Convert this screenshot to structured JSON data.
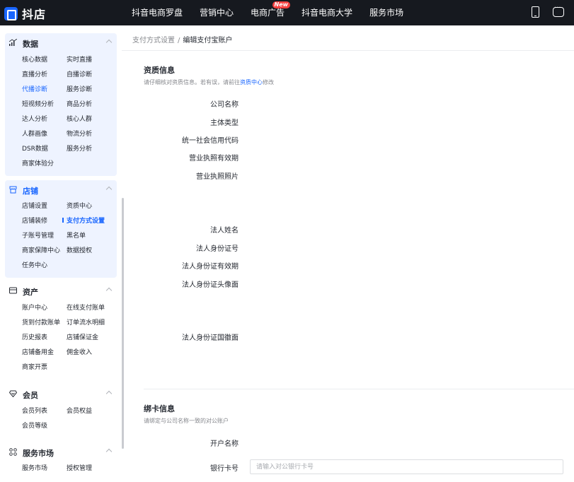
{
  "app": {
    "logo_text": "抖店"
  },
  "topnav": {
    "items": [
      {
        "label": "抖音电商罗盘"
      },
      {
        "label": "营销中心"
      },
      {
        "label": "电商广告",
        "badge": "New"
      },
      {
        "label": "抖音电商大学"
      },
      {
        "label": "服务市场"
      }
    ],
    "icons": [
      "phone-icon",
      "chat-icon"
    ]
  },
  "sidebar": {
    "groups": [
      {
        "title": "数据",
        "icon": "chart-icon",
        "items": [
          "核心数据",
          "实时直播",
          "直播分析",
          "自播诊断",
          "代播诊断",
          "服务诊断",
          "短视频分析",
          "商品分析",
          "达人分析",
          "核心人群",
          "人群画像",
          "物流分析",
          "DSR数据",
          "服务分析",
          "商家体验分"
        ],
        "active_item": "代播诊断"
      },
      {
        "title": "店铺",
        "icon": "store-icon",
        "items": [
          "店铺设置",
          "资质中心",
          "店铺装修",
          "支付方式设置",
          "子账号管理",
          "黑名单",
          "商家保障中心",
          "数据授权",
          "任务中心"
        ],
        "selected_item": "支付方式设置"
      },
      {
        "title": "资产",
        "icon": "wallet-icon",
        "items": [
          "账户中心",
          "在线支付账单",
          "货到付款账单",
          "订单流水明细",
          "历史报表",
          "店铺保证金",
          "店铺备用金",
          "佣金收入",
          "商家开票"
        ]
      },
      {
        "title": "会员",
        "icon": "member-icon",
        "items": [
          "会员列表",
          "会员权益",
          "会员等级"
        ]
      },
      {
        "title": "服务市场",
        "icon": "apps-icon",
        "items": [
          "服务市场",
          "授权管理"
        ]
      }
    ]
  },
  "breadcrumb": {
    "parent": "支付方式设置",
    "separator": "/",
    "current": "编辑支付宝账户"
  },
  "qualification": {
    "title": "资质信息",
    "subtitle_prefix": "请仔细核对资质信息。若有误，请前往",
    "subtitle_link": "资质中心",
    "subtitle_suffix": "修改",
    "fields": [
      "公司名称",
      "主体类型",
      "统一社会信用代码",
      "营业执照有效期",
      "营业执照照片",
      "法人姓名",
      "法人身份证号",
      "法人身份证有效期",
      "法人身份证头像面",
      "法人身份证国徽面"
    ]
  },
  "bank": {
    "title": "绑卡信息",
    "subtitle": "请绑定与公司名称一致的对公账户",
    "fields": [
      "开户名称",
      "银行卡号"
    ],
    "card_placeholder": "请输入对公银行卡号"
  }
}
